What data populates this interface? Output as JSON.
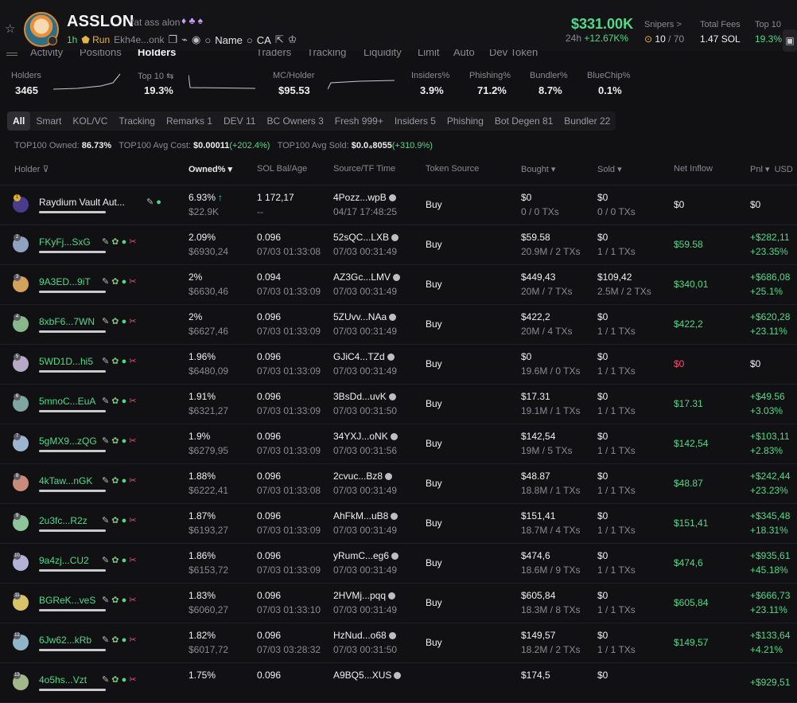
{
  "header": {
    "token_name": "ASSLON",
    "token_desc": "fat ass alon",
    "age": "1h",
    "run_label": "Run",
    "address": "Ekh4e...onk",
    "name_label": "Name",
    "ca_label": "CA",
    "market_cap": "$331.00K",
    "change_24h_label": "24h",
    "change_24h": "+12.67K%",
    "snipers_label": "Snipers >",
    "snipers_value": "10",
    "snipers_total": "/ 70",
    "total_fees_label": "Total Fees",
    "total_fees_value": "1.47 SOL",
    "top10_label": "Top 10",
    "top10_value": "19.3%"
  },
  "top_tabs": [
    "Activity",
    "Positions",
    "Holders",
    "Traders",
    "Tracking",
    "Liquidity",
    "Limit",
    "Auto",
    "Dev Token"
  ],
  "stats": {
    "holders_label": "Holders",
    "holders_value": "3465",
    "top10_label": "Top 10",
    "top10_value": "19.3%",
    "mc_holder_label": "MC/Holder",
    "mc_holder_value": "$95.53",
    "insiders_label": "Insiders%",
    "insiders_value": "3.9%",
    "phishing_label": "Phishing%",
    "phishing_value": "71.2%",
    "bundler_label": "Bundler%",
    "bundler_value": "8.7%",
    "bluechip_label": "BlueChip%",
    "bluechip_value": "0.1%"
  },
  "filters": [
    "All",
    "Smart",
    "KOL/VC",
    "Tracking",
    "Remarks 1",
    "DEV 11",
    "BC Owners 3",
    "Fresh 999+",
    "Insiders 5",
    "Phishing",
    "Bot Degen 81",
    "Bundler 22"
  ],
  "summary": {
    "owned_label": "TOP100 Owned:",
    "owned_value": "86.73%",
    "avg_cost_label": "TOP100 Avg Cost:",
    "avg_cost_value": "$0.00011",
    "avg_cost_change": "(+202.4%)",
    "avg_sold_label": "TOP100 Avg Sold:",
    "avg_sold_value": "$0.0₄8055",
    "avg_sold_change": "(+310.9%)"
  },
  "columns": {
    "holder": "Holder",
    "owned": "Owned%",
    "sol_bal": "SOL Bal/Age",
    "source": "Source/TF Time",
    "token_source": "Token Source",
    "bought": "Bought",
    "sold": "Sold",
    "net_inflow": "Net Inflow",
    "pnl": "Pnl",
    "usd": "USD"
  },
  "colors": {
    "accent_green": "#52d98a",
    "red": "#f0506e",
    "background": "#111113"
  },
  "rows": [
    {
      "rank": "1",
      "name": "Raydium Vault Aut...",
      "owned": "6.93%",
      "owned_usd": "$22.9K",
      "sol": "1 172,17",
      "age": "--",
      "source": "4Pozz...wpB",
      "time": "04/17 17:48:25",
      "token_source": "Buy",
      "bought": "$0",
      "bought_sub": "0 / 0 TXs",
      "sold": "$0",
      "sold_sub": "0 / 0 TXs",
      "net": "$0",
      "pnl": "$0",
      "pnl_pct": ""
    },
    {
      "rank": "2",
      "name": "FKyFj...SxG",
      "owned": "2.09%",
      "owned_usd": "$6930,24",
      "sol": "0.096",
      "age": "07/03 01:33:08",
      "source": "52sQC...LXB",
      "time": "07/03 00:31:49",
      "token_source": "Buy",
      "bought": "$59.58",
      "bought_sub": "20.9M / 2 TXs",
      "sold": "$0",
      "sold_sub": "1 / 1 TXs",
      "net": "$59.58",
      "pnl": "+$282,11",
      "pnl_pct": "+23.35%"
    },
    {
      "rank": "3",
      "name": "9A3ED...9iT",
      "owned": "2%",
      "owned_usd": "$6630,46",
      "sol": "0.094",
      "age": "07/03 01:33:09",
      "source": "AZ3Gc...LMV",
      "time": "07/03 00:31:49",
      "token_source": "Buy",
      "bought": "$449,43",
      "bought_sub": "20M / 7 TXs",
      "sold": "$109,42",
      "sold_sub": "2.5M / 2 TXs",
      "net": "$340,01",
      "pnl": "+$686,08",
      "pnl_pct": "+25.1%"
    },
    {
      "rank": "4",
      "name": "8xbF6...7WN",
      "owned": "2%",
      "owned_usd": "$6627,46",
      "sol": "0.096",
      "age": "07/03 01:33:09",
      "source": "5ZUvv...NAa",
      "time": "07/03 00:31:49",
      "token_source": "Buy",
      "bought": "$422,2",
      "bought_sub": "20M / 4 TXs",
      "sold": "$0",
      "sold_sub": "1 / 1 TXs",
      "net": "$422,2",
      "pnl": "+$620,28",
      "pnl_pct": "+23.11%"
    },
    {
      "rank": "5",
      "name": "5WD1D...hi5",
      "owned": "1.96%",
      "owned_usd": "$6480,09",
      "sol": "0.096",
      "age": "07/03 01:33:09",
      "source": "GJiC4...TZd",
      "time": "07/03 00:31:49",
      "token_source": "Buy",
      "bought": "$0",
      "bought_sub": "19.6M / 0 TXs",
      "sold": "$0",
      "sold_sub": "1 / 1 TXs",
      "net": "$0",
      "pnl": "$0",
      "pnl_pct": ""
    },
    {
      "rank": "6",
      "name": "5mnoC...EuA",
      "owned": "1.91%",
      "owned_usd": "$6321,27",
      "sol": "0.096",
      "age": "07/03 01:33:09",
      "source": "3BsDd...uvK",
      "time": "07/03 00:31:50",
      "token_source": "Buy",
      "bought": "$17.31",
      "bought_sub": "19.1M / 1 TXs",
      "sold": "$0",
      "sold_sub": "1 / 1 TXs",
      "net": "$17.31",
      "pnl": "+$49.56",
      "pnl_pct": "+3.03%"
    },
    {
      "rank": "7",
      "name": "5gMX9...zQG",
      "owned": "1.9%",
      "owned_usd": "$6279,95",
      "sol": "0.096",
      "age": "07/03 01:33:09",
      "source": "34YXJ...oNK",
      "time": "07/03 00:31:56",
      "token_source": "Buy",
      "bought": "$142,54",
      "bought_sub": "19M / 5 TXs",
      "sold": "$0",
      "sold_sub": "1 / 1 TXs",
      "net": "$142,54",
      "pnl": "+$103,11",
      "pnl_pct": "+2.83%"
    },
    {
      "rank": "8",
      "name": "4kTaw...nGK",
      "owned": "1.88%",
      "owned_usd": "$6222,41",
      "sol": "0.096",
      "age": "07/03 01:33:08",
      "source": "2cvuc...Bz8",
      "time": "07/03 00:31:49",
      "token_source": "Buy",
      "bought": "$48.87",
      "bought_sub": "18.8M / 1 TXs",
      "sold": "$0",
      "sold_sub": "1 / 1 TXs",
      "net": "$48.87",
      "pnl": "+$242,44",
      "pnl_pct": "+23.23%"
    },
    {
      "rank": "9",
      "name": "2u3fc...R2z",
      "owned": "1.87%",
      "owned_usd": "$6193,27",
      "sol": "0.096",
      "age": "07/03 01:33:09",
      "source": "AhFkM...uB8",
      "time": "07/03 00:31:49",
      "token_source": "Buy",
      "bought": "$151,41",
      "bought_sub": "18.7M / 4 TXs",
      "sold": "$0",
      "sold_sub": "1 / 1 TXs",
      "net": "$151,41",
      "pnl": "+$345,48",
      "pnl_pct": "+18.31%"
    },
    {
      "rank": "10",
      "name": "9a4zj...CU2",
      "owned": "1.86%",
      "owned_usd": "$6153,72",
      "sol": "0.096",
      "age": "07/03 01:33:09",
      "source": "yRumC...eg6",
      "time": "07/03 00:31:49",
      "token_source": "Buy",
      "bought": "$474,6",
      "bought_sub": "18.6M / 9 TXs",
      "sold": "$0",
      "sold_sub": "1 / 1 TXs",
      "net": "$474,6",
      "pnl": "+$935,61",
      "pnl_pct": "+45.18%"
    },
    {
      "rank": "11",
      "name": "BGReK...veS",
      "owned": "1.83%",
      "owned_usd": "$6060,27",
      "sol": "0.096",
      "age": "07/03 01:33:10",
      "source": "2HVMj...pqq",
      "time": "07/03 00:31:49",
      "token_source": "Buy",
      "bought": "$605,84",
      "bought_sub": "18.3M / 8 TXs",
      "sold": "$0",
      "sold_sub": "1 / 1 TXs",
      "net": "$605,84",
      "pnl": "+$666,73",
      "pnl_pct": "+23.11%"
    },
    {
      "rank": "12",
      "name": "6Jw62...kRb",
      "owned": "1.82%",
      "owned_usd": "$6017,72",
      "sol": "0.096",
      "age": "07/03 03:28:32",
      "source": "HzNud...o68",
      "time": "07/03 00:31:50",
      "token_source": "Buy",
      "bought": "$149,57",
      "bought_sub": "18.2M / 2 TXs",
      "sold": "$0",
      "sold_sub": "1 / 1 TXs",
      "net": "$149,57",
      "pnl": "+$133,64",
      "pnl_pct": "+4.21%"
    },
    {
      "rank": "13",
      "name": "4o5hs...Vzt",
      "owned": "1.75%",
      "owned_usd": "",
      "sol": "0.096",
      "age": "",
      "source": "A9BQ5...XUS",
      "time": "",
      "token_source": "",
      "bought": "$174,5",
      "bought_sub": "",
      "sold": "$0",
      "sold_sub": "",
      "net": "",
      "pnl": "+$929,51",
      "pnl_pct": ""
    }
  ]
}
